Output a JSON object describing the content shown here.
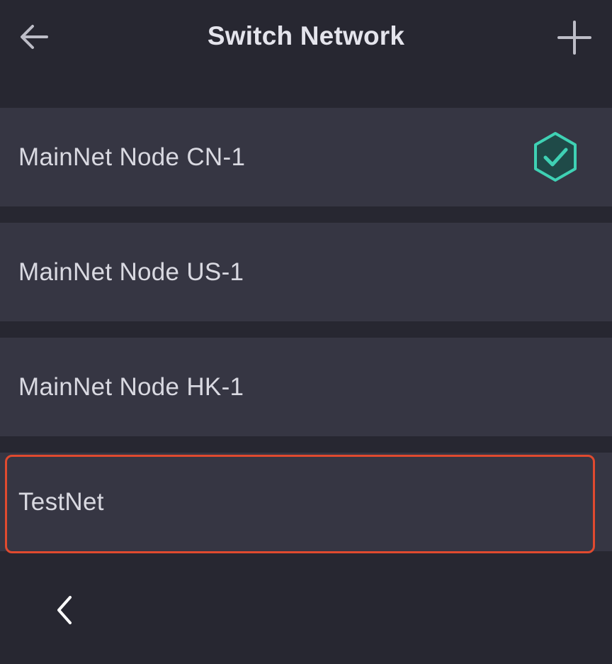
{
  "header": {
    "title": "Switch Network",
    "back_icon": "arrow-left-icon",
    "add_icon": "plus-icon"
  },
  "networks": [
    {
      "label": "MainNet Node CN-1",
      "selected": true
    },
    {
      "label": "MainNet Node US-1",
      "selected": false
    },
    {
      "label": "MainNet Node HK-1",
      "selected": false
    },
    {
      "label": "TestNet",
      "selected": false,
      "highlighted": true
    }
  ],
  "colors": {
    "background": "#272731",
    "row": "#363643",
    "text": "#d9d9e1",
    "accent": "#3fd1b4",
    "highlight": "#e04a2f"
  },
  "footer": {
    "nav_back_icon": "chevron-left-icon"
  }
}
